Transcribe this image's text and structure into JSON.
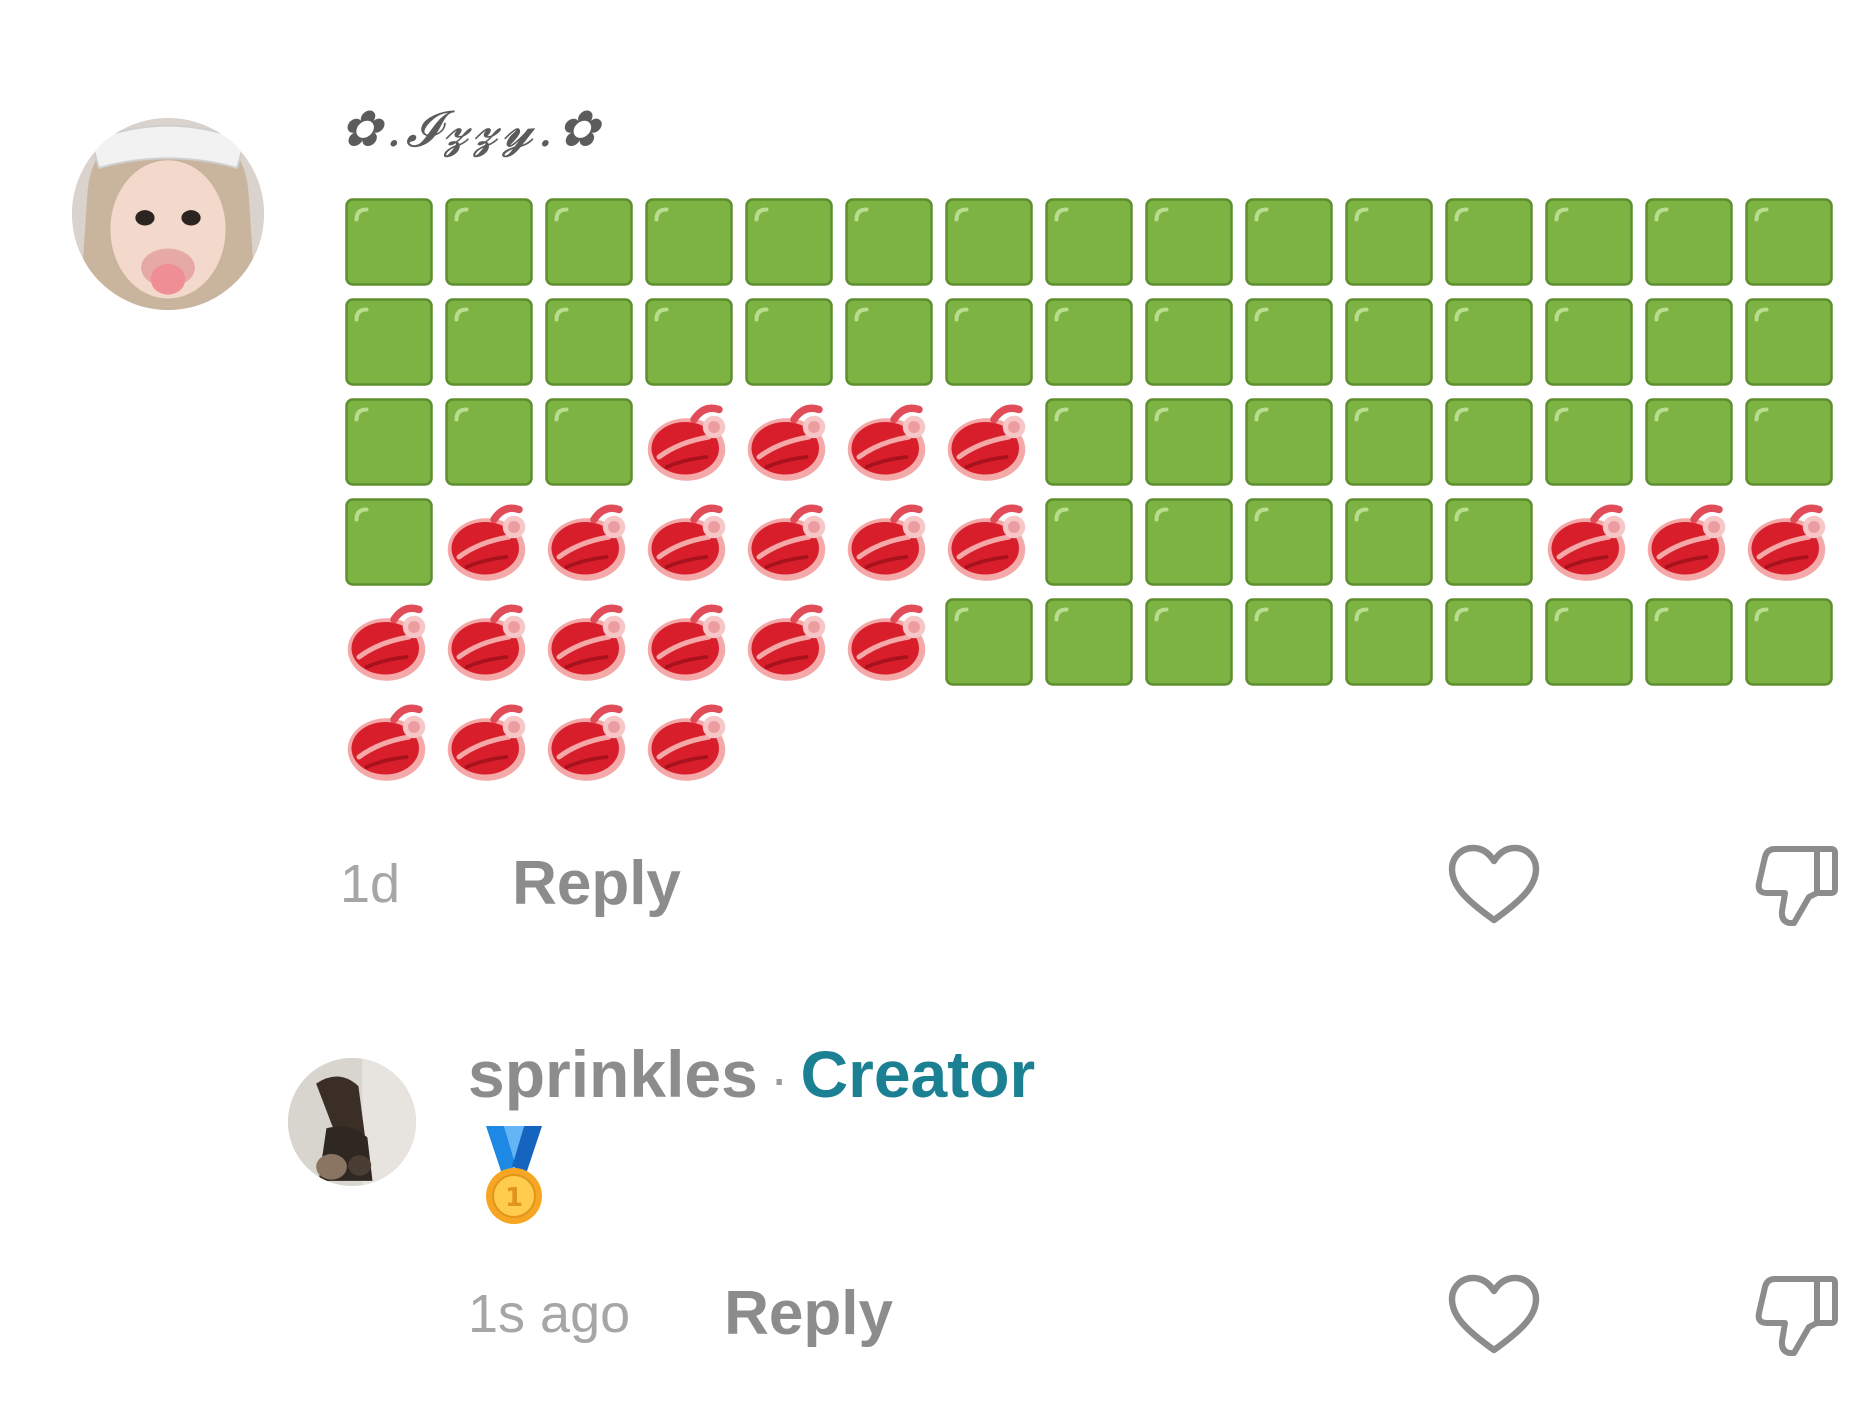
{
  "comments": [
    {
      "username": "✿.𝓘𝔃𝔃𝔂.✿",
      "avatar": "profile-photo-girl-sunglasses",
      "emoji_rows": [
        [
          "green-square",
          "green-square",
          "green-square",
          "green-square",
          "green-square",
          "green-square",
          "green-square",
          "green-square",
          "green-square",
          "green-square",
          "green-square",
          "green-square",
          "green-square",
          "green-square",
          "green-square"
        ],
        [
          "green-square",
          "green-square",
          "green-square",
          "green-square",
          "green-square",
          "green-square",
          "green-square",
          "green-square",
          "green-square",
          "green-square",
          "green-square",
          "green-square",
          "green-square",
          "green-square",
          "green-square"
        ],
        [
          "green-square",
          "green-square",
          "green-square",
          "steak",
          "steak",
          "steak",
          "steak",
          "green-square",
          "green-square",
          "green-square",
          "green-square",
          "green-square",
          "green-square",
          "green-square",
          "green-square"
        ],
        [
          "green-square",
          "steak",
          "steak",
          "steak",
          "steak",
          "steak",
          "steak",
          "green-square",
          "green-square",
          "green-square",
          "green-square",
          "green-square",
          "steak",
          "steak",
          "steak"
        ],
        [
          "steak",
          "steak",
          "steak",
          "steak",
          "steak",
          "steak",
          "green-square",
          "green-square",
          "green-square",
          "green-square",
          "green-square",
          "green-square",
          "green-square",
          "green-square",
          "green-square"
        ],
        [
          "steak",
          "steak",
          "steak",
          "steak"
        ]
      ],
      "time": "1d",
      "reply_label": "Reply",
      "like_icon": "heart-outline-icon",
      "dislike_icon": "thumbs-down-outline-icon"
    },
    {
      "username": "sprinkles",
      "separator": "·",
      "badge": "Creator",
      "avatar": "profile-photo-dark",
      "content_emoji": "first-place-medal",
      "time": "1s ago",
      "reply_label": "Reply",
      "like_icon": "heart-outline-icon",
      "dislike_icon": "thumbs-down-outline-icon"
    }
  ],
  "colors": {
    "green_square": "#7cb342",
    "creator_badge": "#1b8192",
    "meta_text": "#a6a6a6",
    "reply_text": "#8c8c8c",
    "icon_stroke": "#8c8c8c"
  }
}
